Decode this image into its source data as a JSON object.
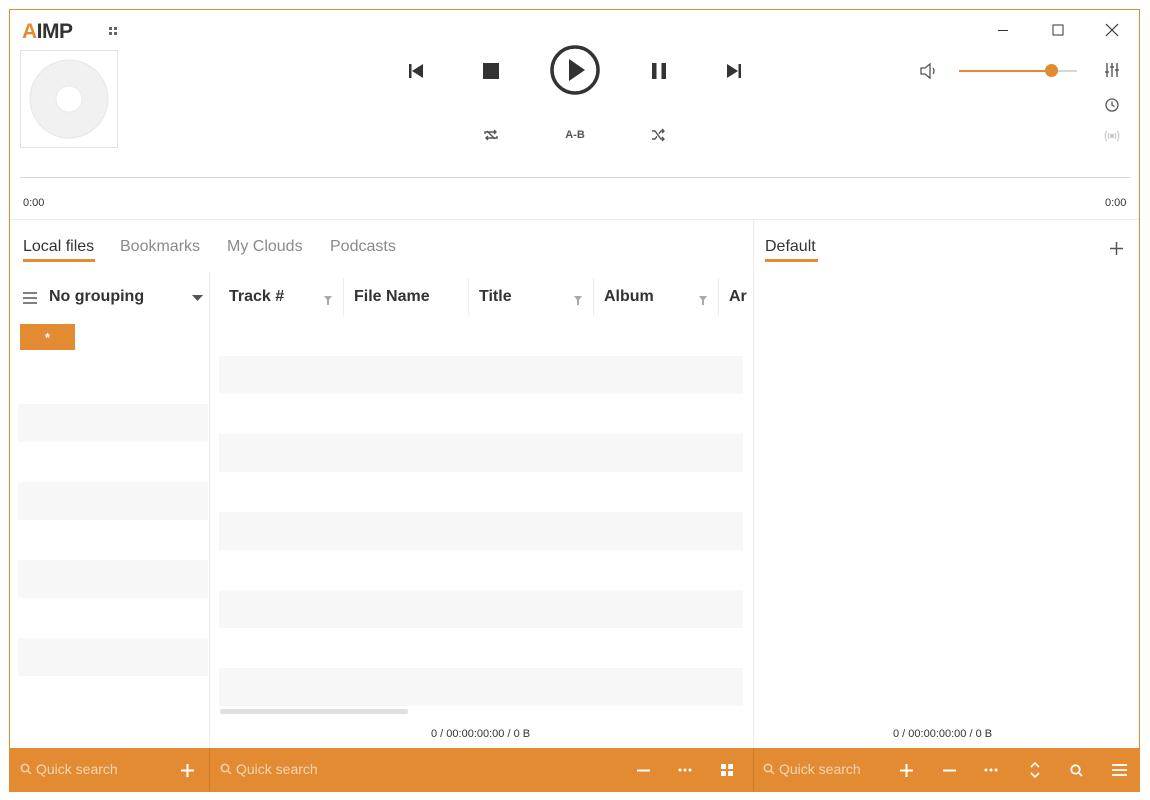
{
  "app": {
    "logo_accent": "A",
    "logo_text": "IMP"
  },
  "colors": {
    "accent": "#e38b32",
    "text": "#333333",
    "muted": "#8a8a8a",
    "stripe": "#f7f7f7"
  },
  "player": {
    "time_elapsed": "0:00",
    "time_total": "0:00",
    "ab_label": "A-B",
    "volume": 0.78
  },
  "library": {
    "tabs": [
      {
        "label": "Local files",
        "active": true
      },
      {
        "label": "Bookmarks",
        "active": false
      },
      {
        "label": "My Clouds",
        "active": false
      },
      {
        "label": "Podcasts",
        "active": false
      }
    ],
    "grouping_label": "No grouping",
    "group_item": "*",
    "columns": [
      "Track #",
      "File Name",
      "Title",
      "Album",
      "Ar"
    ],
    "status": "0 / 00:00:00:00 / 0 B"
  },
  "playlist": {
    "tab_label": "Default",
    "status": "0 / 00:00:00:00 / 0 B"
  },
  "footer": {
    "search_placeholder_1": "Quick search",
    "search_placeholder_2": "Quick search",
    "search_placeholder_3": "Quick search"
  }
}
